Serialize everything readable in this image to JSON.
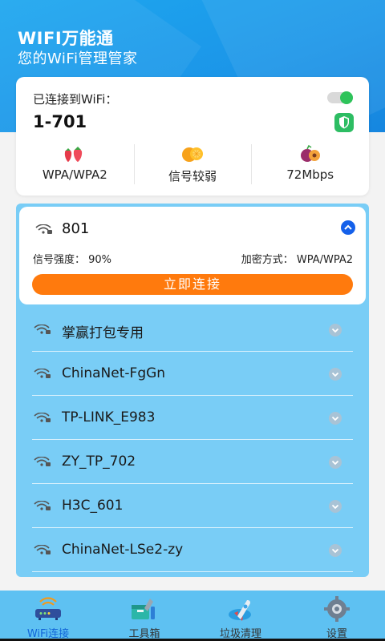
{
  "header": {
    "title": "WIFI万能通",
    "subtitle": "您的WiFi管理管家"
  },
  "connected": {
    "label": "已连接到WiFi：",
    "ssid": "1-701",
    "toggle_on": true,
    "stats": [
      {
        "icon": "strawberry-icon",
        "text": "WPA/WPA2"
      },
      {
        "icon": "orange-icon",
        "text": "信号较弱"
      },
      {
        "icon": "plum-icon",
        "text": "72Mbps"
      }
    ]
  },
  "expanded_network": {
    "ssid": "801",
    "strength_text": "信号强度：  90%",
    "encryption_text": "加密方式：  WPA/WPA2",
    "connect_label": "立即连接"
  },
  "networks": [
    {
      "ssid": "掌赢打包专用"
    },
    {
      "ssid": "ChinaNet-FgGn"
    },
    {
      "ssid": "TP-LINK_E983"
    },
    {
      "ssid": "ZY_TP_702"
    },
    {
      "ssid": "H3C_601"
    },
    {
      "ssid": "ChinaNet-LSe2-zy"
    }
  ],
  "tabs": [
    {
      "label": "WiFi连接",
      "icon": "router-icon",
      "active": true
    },
    {
      "label": "工具箱",
      "icon": "toolbox-icon",
      "active": false
    },
    {
      "label": "垃圾清理",
      "icon": "rocket-icon",
      "active": false
    },
    {
      "label": "设置",
      "icon": "gear-icon",
      "active": false
    }
  ],
  "colors": {
    "primary_blue": "#1b95e8",
    "list_panel": "#79cdf6",
    "connect_button": "#ff7a0d",
    "tabbar": "#5ec1f2",
    "active_tab_text": "#1266d8",
    "toggle_green": "#2ec35a"
  }
}
